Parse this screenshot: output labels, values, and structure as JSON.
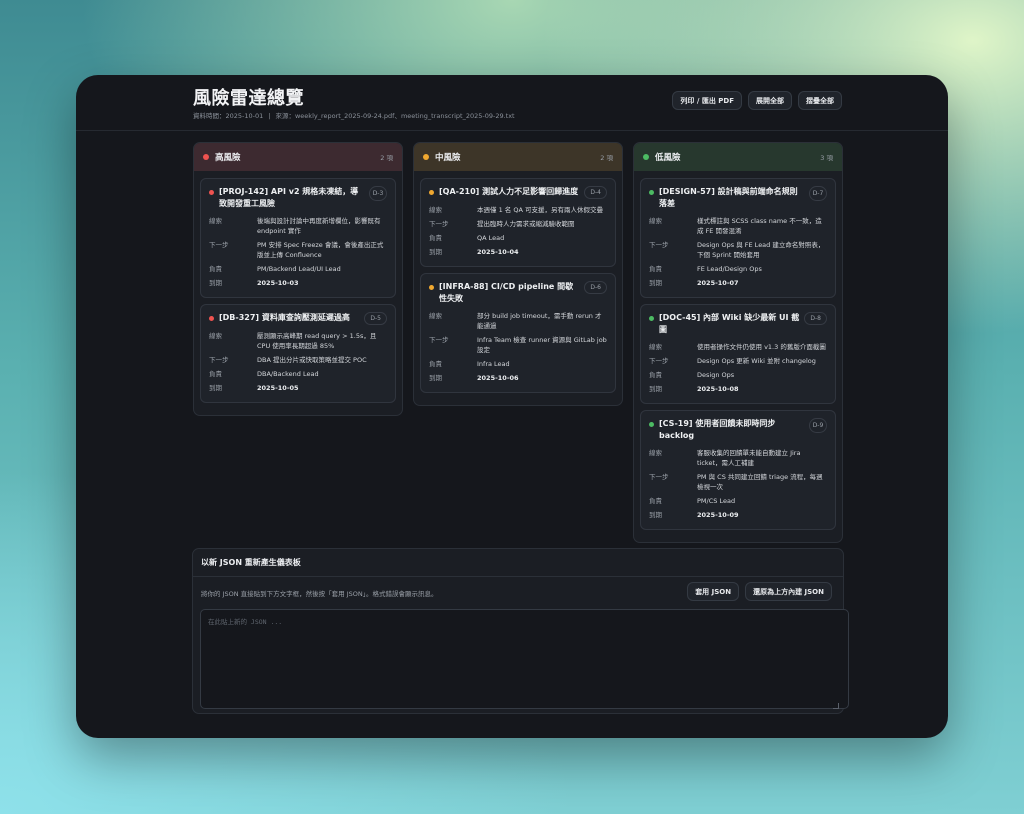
{
  "header": {
    "title": "風險雷達總覽",
    "date_label": "資料時間：2025-10-01",
    "sep": "|",
    "sources_label": "來源：weekly_report_2025-09-24.pdf、meeting_transcript_2025-09-29.txt",
    "buttons": {
      "print": "列印 / 匯出 PDF",
      "expand": "展開全部",
      "collapse": "摺疊全部"
    }
  },
  "field_labels": {
    "clue": "線索",
    "next": "下一步",
    "owner": "負責",
    "due": "到期"
  },
  "columns": [
    {
      "title": "高風險",
      "count": "2 項",
      "color": "#ef5350",
      "cards": [
        {
          "title": "[PROJ-142] API v2 規格未凍結，導致開發重工風險",
          "badge": "D-3",
          "clue": "後端與設計討論中再度新增欄位，影響既有 endpoint 實作",
          "next": "PM 安排 Spec Freeze 會議，會後產出正式版並上傳 Confluence",
          "owner": "PM/Backend Lead/UI Lead",
          "due": "2025-10-03"
        },
        {
          "title": "[DB-327] 資料庫查詢壓測延遲過高",
          "badge": "D-5",
          "clue": "壓測顯示高峰期 read query > 1.5s，且 CPU 使用率長期超過 85%",
          "next": "DBA 提出分片或快取策略並提交 POC",
          "owner": "DBA/Backend Lead",
          "due": "2025-10-05"
        }
      ]
    },
    {
      "title": "中風險",
      "count": "2 項",
      "color": "#f0a830",
      "cards": [
        {
          "title": "[QA-210] 測試人力不足影響回歸進度",
          "badge": "D-4",
          "clue": "本週僅 1 名 QA 可支援，另有兩人休假交疊",
          "next": "提出臨時人力需求或縮減驗收範圍",
          "owner": "QA Lead",
          "due": "2025-10-04"
        },
        {
          "title": "[INFRA-88] CI/CD pipeline 間歇性失敗",
          "badge": "D-6",
          "clue": "部分 build job timeout，需手動 rerun 才能通過",
          "next": "Infra Team 檢查 runner 資源與 GitLab job 設定",
          "owner": "Infra Lead",
          "due": "2025-10-06"
        }
      ]
    },
    {
      "title": "低風險",
      "count": "3 項",
      "color": "#4cbb63",
      "cards": [
        {
          "title": "[DESIGN-57] 設計稿與前端命名規則落差",
          "badge": "D-7",
          "clue": "樣式標註與 SCSS class name 不一致，造成 FE 開發混淆",
          "next": "Design Ops 與 FE Lead 建立命名對照表，下個 Sprint 開始套用",
          "owner": "FE Lead/Design Ops",
          "due": "2025-10-07"
        },
        {
          "title": "[DOC-45] 內部 Wiki 缺少最新 UI 截圖",
          "badge": "D-8",
          "clue": "使用者操作文件仍使用 v1.3 的舊版介面截圖",
          "next": "Design Ops 更新 Wiki 並附 changelog",
          "owner": "Design Ops",
          "due": "2025-10-08"
        },
        {
          "title": "[CS-19] 使用者回饋未即時同步 backlog",
          "badge": "D-9",
          "clue": "客服收集的回饋單未能自動建立 Jira ticket，需人工補建",
          "next": "PM 與 CS 共同建立回饋 triage 流程，每週檢視一次",
          "owner": "PM/CS Lead",
          "due": "2025-10-09"
        }
      ]
    }
  ],
  "json_panel": {
    "title": "以新 JSON 重新產生儀表板",
    "description": "將你的 JSON 直接貼到下方文字框，然後按「套用 JSON」。格式錯誤會顯示訊息。",
    "apply_button": "套用 JSON",
    "restore_button": "還原為上方內建 JSON",
    "placeholder": "在此貼上新的 JSON ...",
    "value": ""
  }
}
